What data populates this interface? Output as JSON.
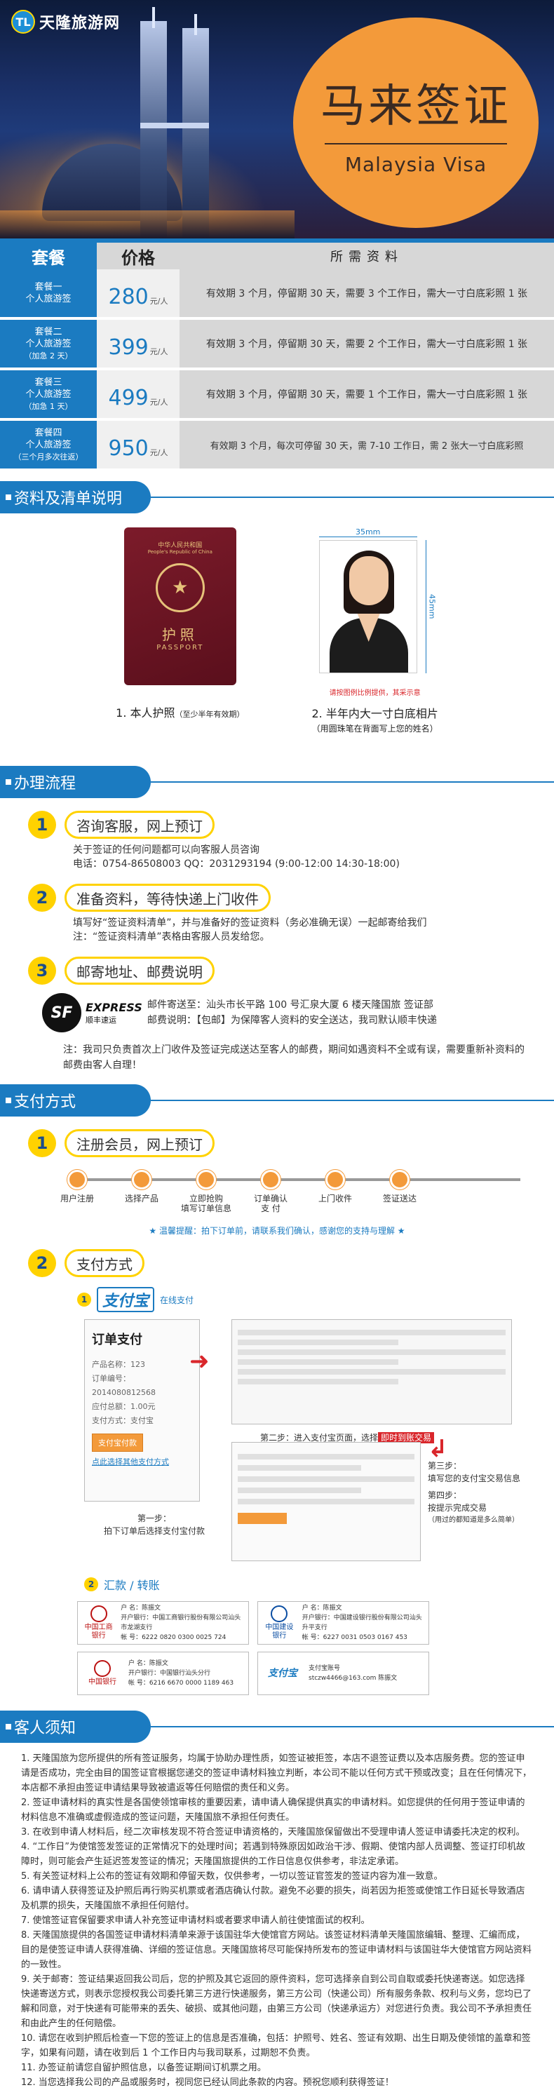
{
  "header": {
    "logo_mark": "TL",
    "logo_text": "天隆旅游网",
    "title_cn": "马来签证",
    "title_en": "Malaysia Visa"
  },
  "packages": {
    "head": [
      "套餐",
      "价格",
      "所需资料"
    ],
    "rows": [
      {
        "name": "套餐一",
        "type": "个人旅游签",
        "note": "",
        "price": "280",
        "unit": "元/人",
        "desc": "有效期 3 个月，停留期 30 天，需要 3 个工作日，需大一寸白底彩照 1 张"
      },
      {
        "name": "套餐二",
        "type": "个人旅游签",
        "note": "（加急 2 天）",
        "price": "399",
        "unit": "元/人",
        "desc": "有效期 3 个月，停留期 30 天，需要 2 个工作日，需大一寸白底彩照 1 张"
      },
      {
        "name": "套餐三",
        "type": "个人旅游签",
        "note": "（加急 1 天）",
        "price": "499",
        "unit": "元/人",
        "desc": "有效期 3 个月，停留期 30 天，需要 1 个工作日，需大一寸白底彩照 1 张"
      },
      {
        "name": "套餐四",
        "type": "个人旅游签",
        "note": "（三个月多次往返）",
        "price": "950",
        "unit": "元/人",
        "desc": "有效期 3 个月，每次可停留 30 天，需 7-10 工作日，需 2 张大一寸白底彩照"
      }
    ]
  },
  "sections": {
    "docs": "资料及清单说明",
    "process": "办理流程",
    "payment": "支付方式",
    "notice": "客人须知"
  },
  "docs": {
    "passport_cn": "中华人民共和国",
    "passport_en": "People's Republic of China",
    "passport_big": "护照",
    "passport_sub": "PASSPORT",
    "item1": "1. 本人护照",
    "item1_small": "（至少半年有效期）",
    "photo_w": "35mm",
    "photo_h": "45mm",
    "photo_note": "请按图例比例提供，其采示意",
    "item2": "2. 半年内大一寸白底相片",
    "item2_sub": "（用圆珠笔在背面写上您的姓名）"
  },
  "process": {
    "s1_title": "咨询客服，网上预订",
    "s1_line1": "关于签证的任何问题都可以向客服人员咨询",
    "s1_line2": "电话：0754-86508003    QQ：2031293194  (9:00-12:00  14:30-18:00)",
    "s2_title": "准备资料，等待快递上门收件",
    "s2_line1": "填写好“签证资料清单”，并与准备好的签证资料（务必准确无误）一起邮寄给我们",
    "s2_line2": "注：“签证资料清单”表格由客服人员发给您。",
    "s3_title": "邮寄地址、邮费说明",
    "sf_mark": "SF",
    "sf_txt1": "EXPRESS",
    "sf_txt2": "顺丰速运",
    "sf_line1": "邮件寄送至：汕头市长平路 100 号汇泉大厦 6 楼天隆国旅 签证部",
    "sf_line2": "邮费说明：【包邮】为保障客人资料的安全送达，我司默认顺丰快递",
    "notice": "注：我司只负责首次上门收件及签证完成送达至客人的邮费，期间如遇资料不全或有误，需要重新补资料的邮费由客人自理！"
  },
  "payment": {
    "s1_title": "注册会员，网上预订",
    "steps": [
      "用户注册",
      "选择产品",
      "立即抢购\n填写订单信息",
      "订单确认\n支  付",
      "上门收件",
      "签证送达"
    ],
    "tip": "★ 温馨提醒：拍下订单前，请联系我们确认，感谢您的支持与理解 ★",
    "s2_title": "支付方式",
    "alipay_logo": "支付宝",
    "alipay_online": "在线支付",
    "order_title": "订单支付",
    "order_lines": [
      "产品名称：123",
      "订单编号：2014080812568",
      "应付总额：1.00元",
      "支付方式：支付宝"
    ],
    "order_btn": "支付宝付款",
    "order_link": "点此选择其他支付方式",
    "step1_cap": "第一步：\n拍下订单后选择支付宝付款",
    "step2_cap": "第二步：进入支付宝页面，选择",
    "step2_hl": "即时到账交易",
    "step3": "第三步：\n填写您的支付宝交易信息",
    "step4": "第四步：\n按提示完成交易",
    "step4_sm": "（用过的都知道是多么简单）",
    "remit_title": "汇款 / 转账",
    "banks": [
      {
        "logo": "中国工商银行",
        "info": "户 名：陈振文\n开户银行：中国工商银行股份有限公司汕头市龙湖支行\n帐 号：6222 0820 0300 0025 724"
      },
      {
        "logo": "中国建设银行",
        "info": "户 名：陈振文\n开户银行：中国建设银行股份有限公司汕头升平支行\n帐 号：6227 0031 0503 0167 453"
      },
      {
        "logo": "中国银行",
        "info": "户 名：陈振文\n开户银行：中国银行汕头分行\n帐 号：6216 6670 0000 1189 463"
      },
      {
        "logo": "支付宝",
        "info": "支付宝账号\nstczw4466@163.com  陈振文"
      }
    ]
  },
  "notes": [
    "1. 天隆国旅为您所提供的所有签证服务，均属于协助办理性质，如签证被拒签，本店不退签证费以及本店服务费。您的签证申请是否成功，完全由目的国签证官根据您递交的签证申请材料独立判断，本公司不能以任何方式干预或改变；且在任何情况下，本店都不承担由签证申请结果导致被遣返等任何赔偿的责任和义务。",
    "2. 签证申请材料的真实性是各国使领馆审核的重要因素，请申请人确保提供真实的申请材料。如您提供的任何用于签证申请的材料信息不准确或虚假造成的签证问题，天隆国旅不承担任何责任。",
    "3. 在收到申请人材料后，经二次审核发现不符合签证申请资格的，天隆国旅保留做出不受理申请人签证申请委托决定的权利。",
    "4. “工作日”为使馆签发签证的正常情况下的处理时间；若遇到特殊原因如政治干涉、假期、使馆内部人员调整、签证打印机故障时，则可能会产生延迟签发签证的情况；天隆国旅提供的工作日信息仅供参考，非法定承诺。",
    "5. 有关签证材料上公布的签证有效期和停留天数，仅供参考，一切以签证官签发的签证内容为准一致意。",
    "6. 请申请人获得签证及护照后再行购买机票或者酒店确认付款。避免不必要的损失，尚若因为拒签或使馆工作日延长导致酒店及机票的损失，天隆国旅不承担任何赔付。",
    "7. 使馆签证官保留要求申请人补充签证申请材料或者要求申请人前往使馆面试的权利。",
    "8. 天隆国旅提供的各国签证申请材料清单来源于该国驻华大使馆官方网站。该签证材料清单天隆国旅编辑、整理、汇编而成，目的是使签证申请人获得准确、详细的签证信息。天隆国旅将尽可能保持所发布的签证申请材料与该国驻华大使馆官方网站资料的一致性。",
    "9. 关于邮寄：签证结果返回我公司后，您的护照及其它返回的原件资料，您可选择亲自到公司自取或委托快递寄送。如您选择快递寄送方式，则表示您授权我公司委托第三方进行快递服务，第三方公司（快递公司）所有服务条款、权利与义务，您均已了解和同意，对于快递有可能带来的丢失、破损、或其他问题，由第三方公司（快递承运方）对您进行负责。我公司不予承担责任和由此产生的任何赔偿。",
    "10. 请您在收到护照后检查一下您的签证上的信息是否准确，包括：护照号、姓名、签证有效期、出生日期及使领馆的盖章和签字，如果有问题，请在收到后 1 个工作日内与我司联系，过期恕不负责。",
    "11. 办签证前请您自留护照信息，以备签证期间订机票之用。",
    "12. 当您选择我公司的产品或服务时，视同您已经认同此条款的内容。预祝您顺利获得签证！"
  ]
}
